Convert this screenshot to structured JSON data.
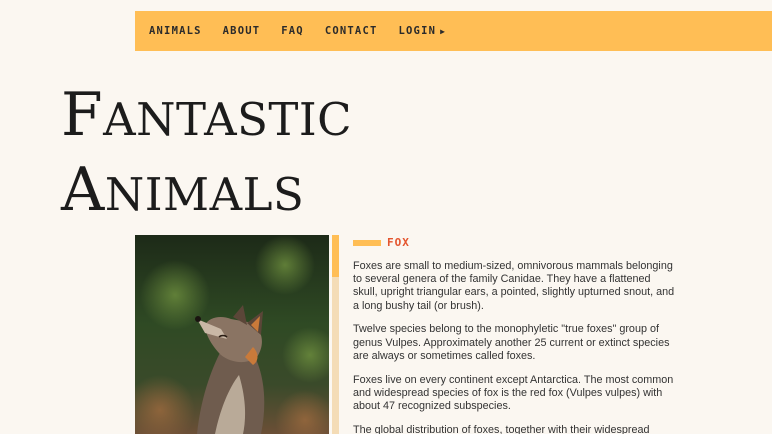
{
  "nav": {
    "items": [
      {
        "label": "ANIMALS"
      },
      {
        "label": "ABOUT"
      },
      {
        "label": "FAQ"
      },
      {
        "label": "CONTACT"
      },
      {
        "label": "LOGIN"
      }
    ],
    "login_arrow": "▶"
  },
  "hero": {
    "line1_cap": "F",
    "line1_rest": "ANTASTIC",
    "line2_cap": "A",
    "line2_rest": "NIMALS"
  },
  "section": {
    "label": "FOX"
  },
  "article": {
    "paragraphs": [
      "Foxes are small to medium-sized, omnivorous mammals belonging to several genera of the family Canidae. They have a flattened skull, upright triangular ears, a pointed, slightly upturned snout, and a long bushy tail (or brush).",
      "Twelve species belong to the monophyletic \"true foxes\" group of genus Vulpes. Approximately another 25 current or extinct species are always or sometimes called foxes.",
      "Foxes live on every continent except Antarctica. The most common and widespread species of fox is the red fox (Vulpes vulpes) with about 47 recognized subspecies.",
      "The global distribution of foxes, together with their widespread"
    ]
  },
  "colors": {
    "accent": "#ffbe55",
    "accent_light": "#f4dcb6",
    "label_red": "#e4552e",
    "background": "#fbf7f1"
  }
}
